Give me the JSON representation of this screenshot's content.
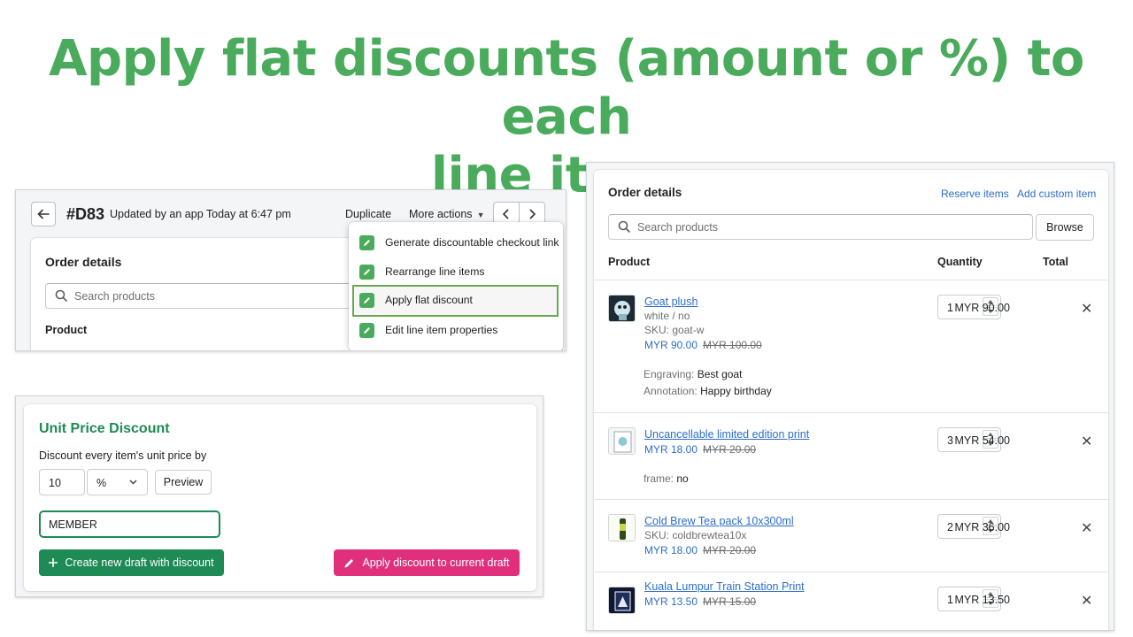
{
  "headline": {
    "line1": "Apply flat discounts (amount or %) to each",
    "line2": "line items"
  },
  "order_header": {
    "order_id": "#D83",
    "meta": "Updated by an app Today at 6:47 pm",
    "duplicate": "Duplicate",
    "more_actions": "More actions",
    "card_title": "Order details",
    "search_placeholder": "Search products",
    "col_product": "Product"
  },
  "more_actions_menu": {
    "items": [
      {
        "label": "Generate discountable checkout link"
      },
      {
        "label": "Rearrange line items"
      },
      {
        "label": "Apply flat discount"
      },
      {
        "label": "Edit line item properties"
      }
    ]
  },
  "discount_form": {
    "title": "Unit Price Discount",
    "description": "Discount every item's unit price by",
    "amount": "10",
    "unit": "%",
    "preview": "Preview",
    "code": "MEMBER",
    "create_button": "Create new draft with discount",
    "apply_button": "Apply discount to current draft"
  },
  "order_details": {
    "title": "Order details",
    "reserve_items": "Reserve items",
    "add_custom_item": "Add custom item",
    "search_placeholder": "Search products",
    "browse": "Browse",
    "col_product": "Product",
    "col_quantity": "Quantity",
    "col_total": "Total",
    "items": [
      {
        "name": "Goat plush",
        "variant": "white / no",
        "sku": "SKU: goat-w",
        "price": "MYR 90.00",
        "original_price": "MYR 100.00",
        "prop1_key": "Engraving:",
        "prop1_val": "Best goat",
        "prop2_key": "Annotation:",
        "prop2_val": "Happy birthday",
        "quantity": "1",
        "total": "MYR 90.00"
      },
      {
        "name": "Uncancellable limited edition print",
        "price": "MYR 18.00",
        "original_price": "MYR 20.00",
        "prop1_key": "frame:",
        "prop1_val": "no",
        "quantity": "3",
        "total": "MYR 54.00"
      },
      {
        "name": "Cold Brew Tea pack 10x300ml",
        "sku": "SKU: coldbrewtea10x",
        "price": "MYR 18.00",
        "original_price": "MYR 20.00",
        "quantity": "2",
        "total": "MYR 36.00"
      },
      {
        "name": "Kuala Lumpur Train Station Print",
        "price": "MYR 13.50",
        "original_price": "MYR 15.00",
        "quantity": "1",
        "total": "MYR 13.50"
      }
    ]
  },
  "colors": {
    "headline_green": "#4aab5c",
    "primary_green": "#1e8a55",
    "highlight_border": "#6aa84f",
    "pink": "#e0307c",
    "link_blue": "#2c6ecb"
  }
}
